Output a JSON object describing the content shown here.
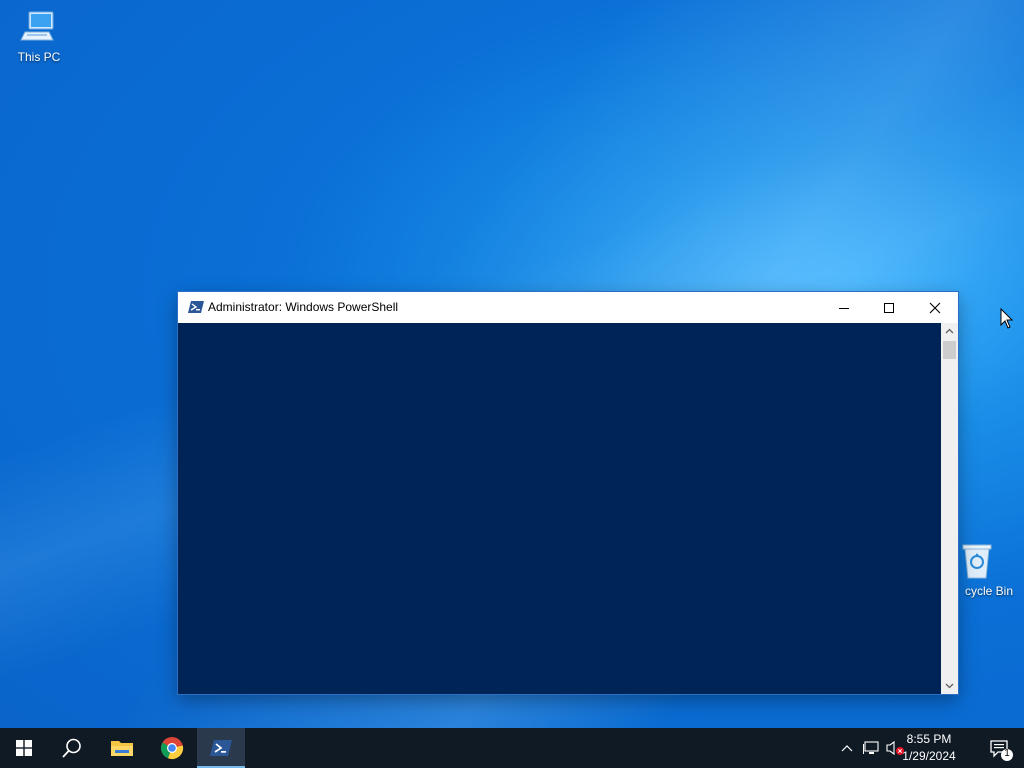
{
  "desktop": {
    "icons": [
      {
        "label": "This PC",
        "icon": "computer-icon"
      },
      {
        "label": "cycle Bin",
        "icon": "recycle-bin-icon"
      }
    ]
  },
  "window": {
    "title": "Administrator: Windows PowerShell",
    "icon": "powershell-icon",
    "console_bg": "#012456",
    "controls": {
      "minimize": "minimize-icon",
      "maximize": "maximize-icon",
      "close": "close-icon"
    }
  },
  "taskbar": {
    "apps": [
      {
        "name": "Start",
        "icon": "windows-logo-icon"
      },
      {
        "name": "Search",
        "icon": "search-icon"
      },
      {
        "name": "File Explorer",
        "icon": "folder-icon"
      },
      {
        "name": "Google Chrome",
        "icon": "chrome-icon"
      },
      {
        "name": "Windows PowerShell",
        "icon": "powershell-icon",
        "active": true
      }
    ],
    "tray": {
      "icons": [
        "chevron-up-icon",
        "network-icon",
        "volume-muted-icon"
      ],
      "time": "8:55 PM",
      "date": "1/29/2024",
      "notification_count": "1"
    }
  },
  "colors": {
    "accent": "#0a6fd6",
    "taskbar": "#101a24",
    "console": "#012456"
  }
}
